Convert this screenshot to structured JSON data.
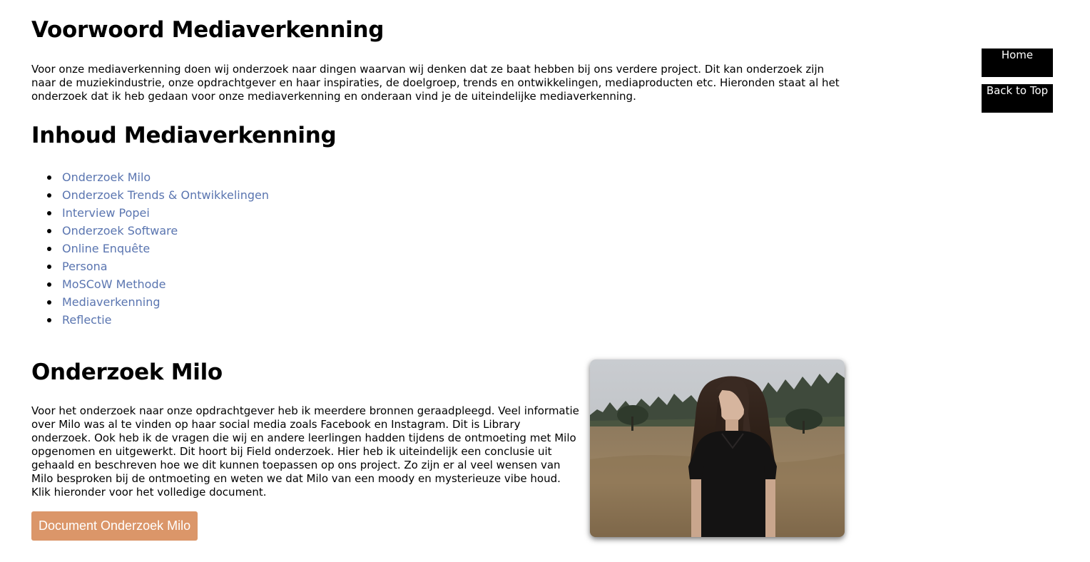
{
  "intro": {
    "title": "Voorwoord Mediaverkenning",
    "body": "Voor onze mediaverkenning doen wij onderzoek naar dingen waarvan wij denken dat ze baat hebben bij ons verdere project. Dit kan onderzoek zijn naar de muziekindustrie, onze opdrachtgever en haar inspiraties, de doelgroep, trends en ontwikkelingen, mediaproducten etc. Hieronden staat al het onderzoek dat ik heb gedaan voor onze mediaverkenning en onderaan vind je de uiteindelijke mediaverkenning."
  },
  "contents": {
    "title": "Inhoud Mediaverkenning",
    "items": [
      {
        "label": "Onderzoek Milo"
      },
      {
        "label": "Onderzoek Trends & Ontwikkelingen"
      },
      {
        "label": "Interview Popei"
      },
      {
        "label": "Onderzoek Software"
      },
      {
        "label": "Online Enquête"
      },
      {
        "label": "Persona"
      },
      {
        "label": "MoSCoW Methode"
      },
      {
        "label": "Mediaverkenning"
      },
      {
        "label": "Reflectie"
      }
    ]
  },
  "milo": {
    "title": "Onderzoek Milo",
    "body": "Voor het onderzoek naar onze opdrachtgever heb ik meerdere bronnen geraadpleegd. Veel informatie over Milo was al te vinden op haar social media zoals Facebook en Instagram. Dit is Library onderzoek. Ook heb ik de vragen die wij en andere leerlingen hadden tijdens de ontmoeting met Milo opgenomen en uitgewerkt. Dit hoort bij Field onderzoek. Hier heb ik uiteindelijk een conclusie uit gehaald en beschreven hoe we dit kunnen toepassen op ons project. Zo zijn er al veel wensen van Milo besproken bij de ontmoeting en weten we dat Milo van een moody en mysterieuze vibe houd. Klik hieronder voor het volledige document.",
    "button_label": "Document Onderzoek Milo"
  },
  "side_nav": {
    "home_label": "Home",
    "top_label": "Back to Top"
  },
  "colors": {
    "link": "#5a75b0",
    "button": "#db9669",
    "nav_bg": "#000000"
  }
}
